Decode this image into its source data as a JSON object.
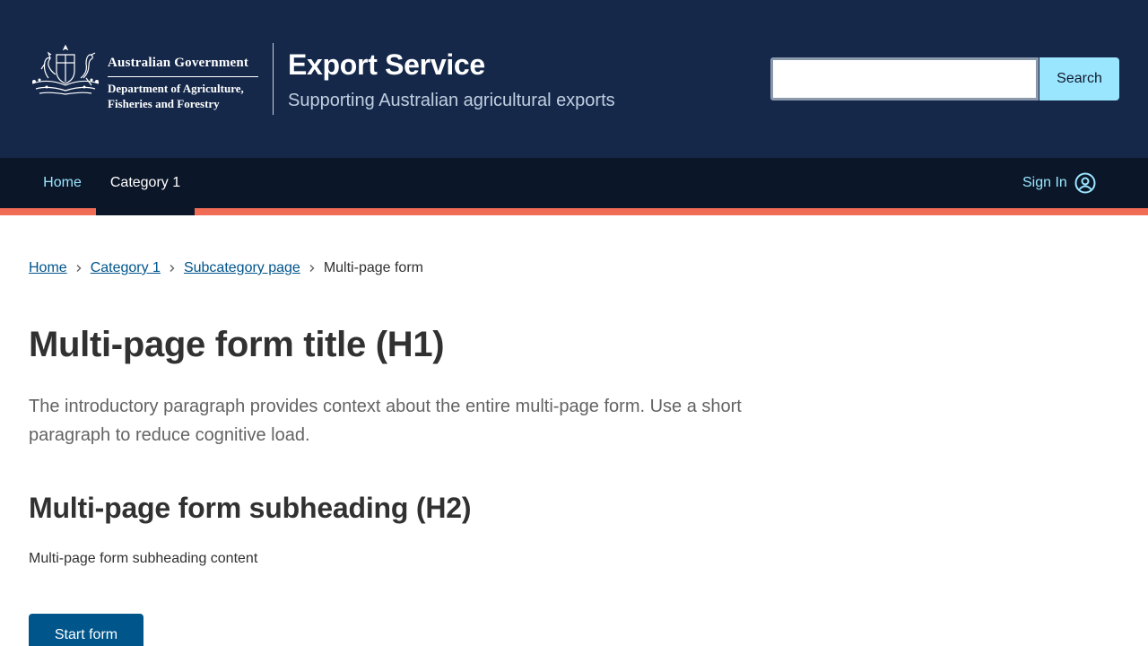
{
  "header": {
    "government_name": "Australian Government",
    "department_name_line1": "Department of Agriculture,",
    "department_name_line2": "Fisheries and Forestry",
    "site_title": "Export Service",
    "site_tagline": "Supporting Australian agricultural exports",
    "search": {
      "value": "",
      "placeholder": "",
      "button_label": "Search"
    }
  },
  "nav": {
    "items": [
      {
        "label": "Home"
      },
      {
        "label": "Category 1"
      }
    ],
    "sign_in_label": "Sign In"
  },
  "breadcrumb": {
    "items": [
      {
        "label": "Home"
      },
      {
        "label": "Category 1"
      },
      {
        "label": "Subcategory page"
      }
    ],
    "current": "Multi-page form"
  },
  "main": {
    "title": "Multi-page form title (H1)",
    "intro": "The introductory paragraph provides context about the entire multi-page form. Use a short paragraph to reduce cognitive load.",
    "subheading": "Multi-page form subheading (H2)",
    "subheading_content": "Multi-page form subheading content",
    "start_button_label": "Start form"
  },
  "colors": {
    "header_bg": "#15284a",
    "nav_bg": "#0b1628",
    "nav_accent": "#f06c55",
    "link": "#00558b",
    "nav_link": "#9be6ff",
    "primary_button": "#00558b"
  },
  "icons": {
    "crest": "australian-coat-of-arms",
    "breadcrumb_separator": "chevron-right-icon",
    "sign_in": "user-circle-icon"
  }
}
